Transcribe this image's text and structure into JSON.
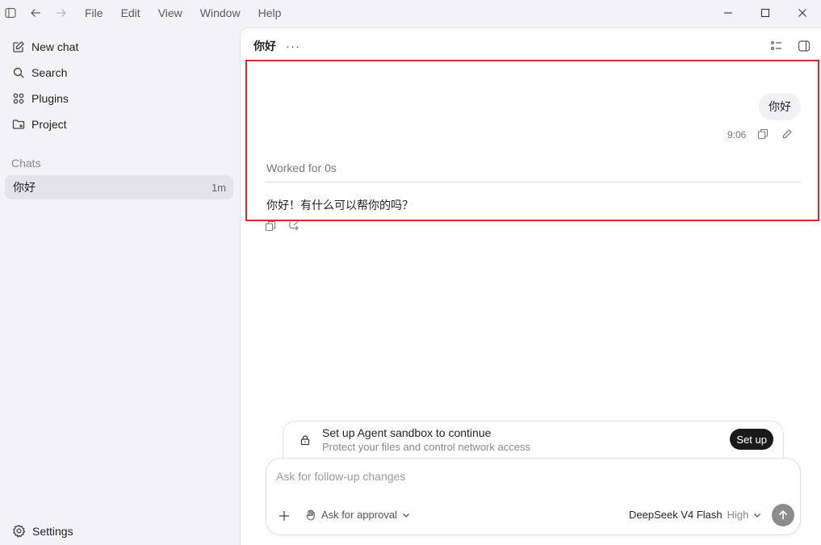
{
  "titlebar": {
    "menu": [
      "File",
      "Edit",
      "View",
      "Window",
      "Help"
    ]
  },
  "sidebar": {
    "nav": [
      {
        "label": "New chat",
        "icon": "edit-icon"
      },
      {
        "label": "Search",
        "icon": "search-icon"
      },
      {
        "label": "Plugins",
        "icon": "plugins-icon"
      },
      {
        "label": "Project",
        "icon": "folder-icon"
      }
    ],
    "section_label": "Chats",
    "chats": [
      {
        "title": "你好",
        "time": "1m"
      }
    ],
    "settings_label": "Settings"
  },
  "main": {
    "title": "你好",
    "more_label": "···",
    "conversation": {
      "user_message": "你好",
      "user_message_time": "9:06",
      "worked_label": "Worked for 0s",
      "assistant_message": "你好！有什么可以帮你的吗？"
    },
    "sandbox": {
      "title": "Set up Agent sandbox to continue",
      "subtitle": "Protect your files and control network access",
      "button_label": "Set up"
    },
    "composer": {
      "placeholder": "Ask for follow-up changes",
      "value": "",
      "approval_label": "Ask for approval",
      "model_name": "DeepSeek V4 Flash",
      "effort_label": "High"
    }
  },
  "colors": {
    "highlight_border": "#e0252b",
    "sidebar_bg": "#f3f3f5",
    "selected_chat_bg": "#e4e4e7",
    "setup_button_bg": "#1a1a1a",
    "send_button_bg": "#8c8c8c"
  }
}
